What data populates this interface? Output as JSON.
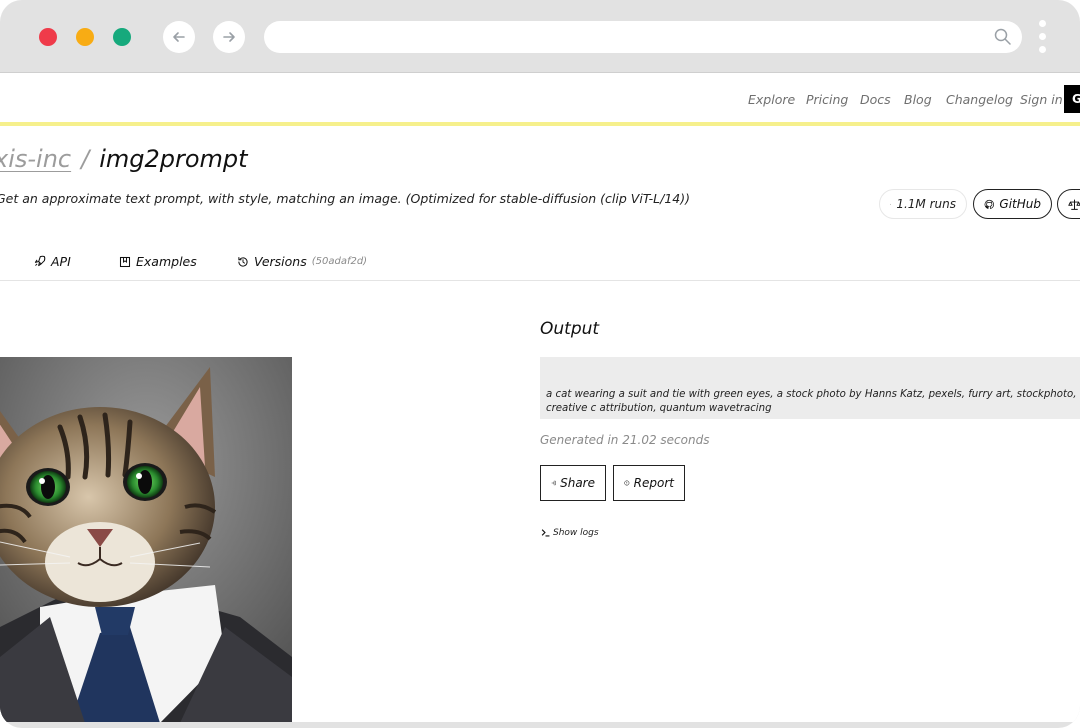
{
  "nav": {
    "items": [
      "Explore",
      "Pricing",
      "Docs",
      "Blog",
      "Changelog",
      "Sign in"
    ],
    "cta_label": "G"
  },
  "model": {
    "owner": "xis-inc",
    "separator": "/",
    "name": "img2prompt",
    "description": "Get an approximate text prompt, with style, matching an image. (Optimized for stable-diffusion (clip ViT-L/14))",
    "runs_label": "1.1M runs",
    "github_label": "GitHub"
  },
  "tabs": {
    "api": "API",
    "examples": "Examples",
    "versions": "Versions",
    "version_id": "(50adaf2d)"
  },
  "output": {
    "title": "Output",
    "text": "a cat wearing a suit and tie with green eyes, a stock photo by Hanns Katz, pexels, furry art, stockphoto, creative c attribution, quantum wavetracing",
    "generated": "Generated in 21.02 seconds",
    "share_label": "Share",
    "report_label": "Report",
    "show_logs_label": "Show logs"
  },
  "colors": {
    "accent_yellow": "#f6f08c",
    "traffic_red": "#ef3b4a",
    "traffic_yellow": "#f8ac14",
    "traffic_green": "#16a97c"
  }
}
